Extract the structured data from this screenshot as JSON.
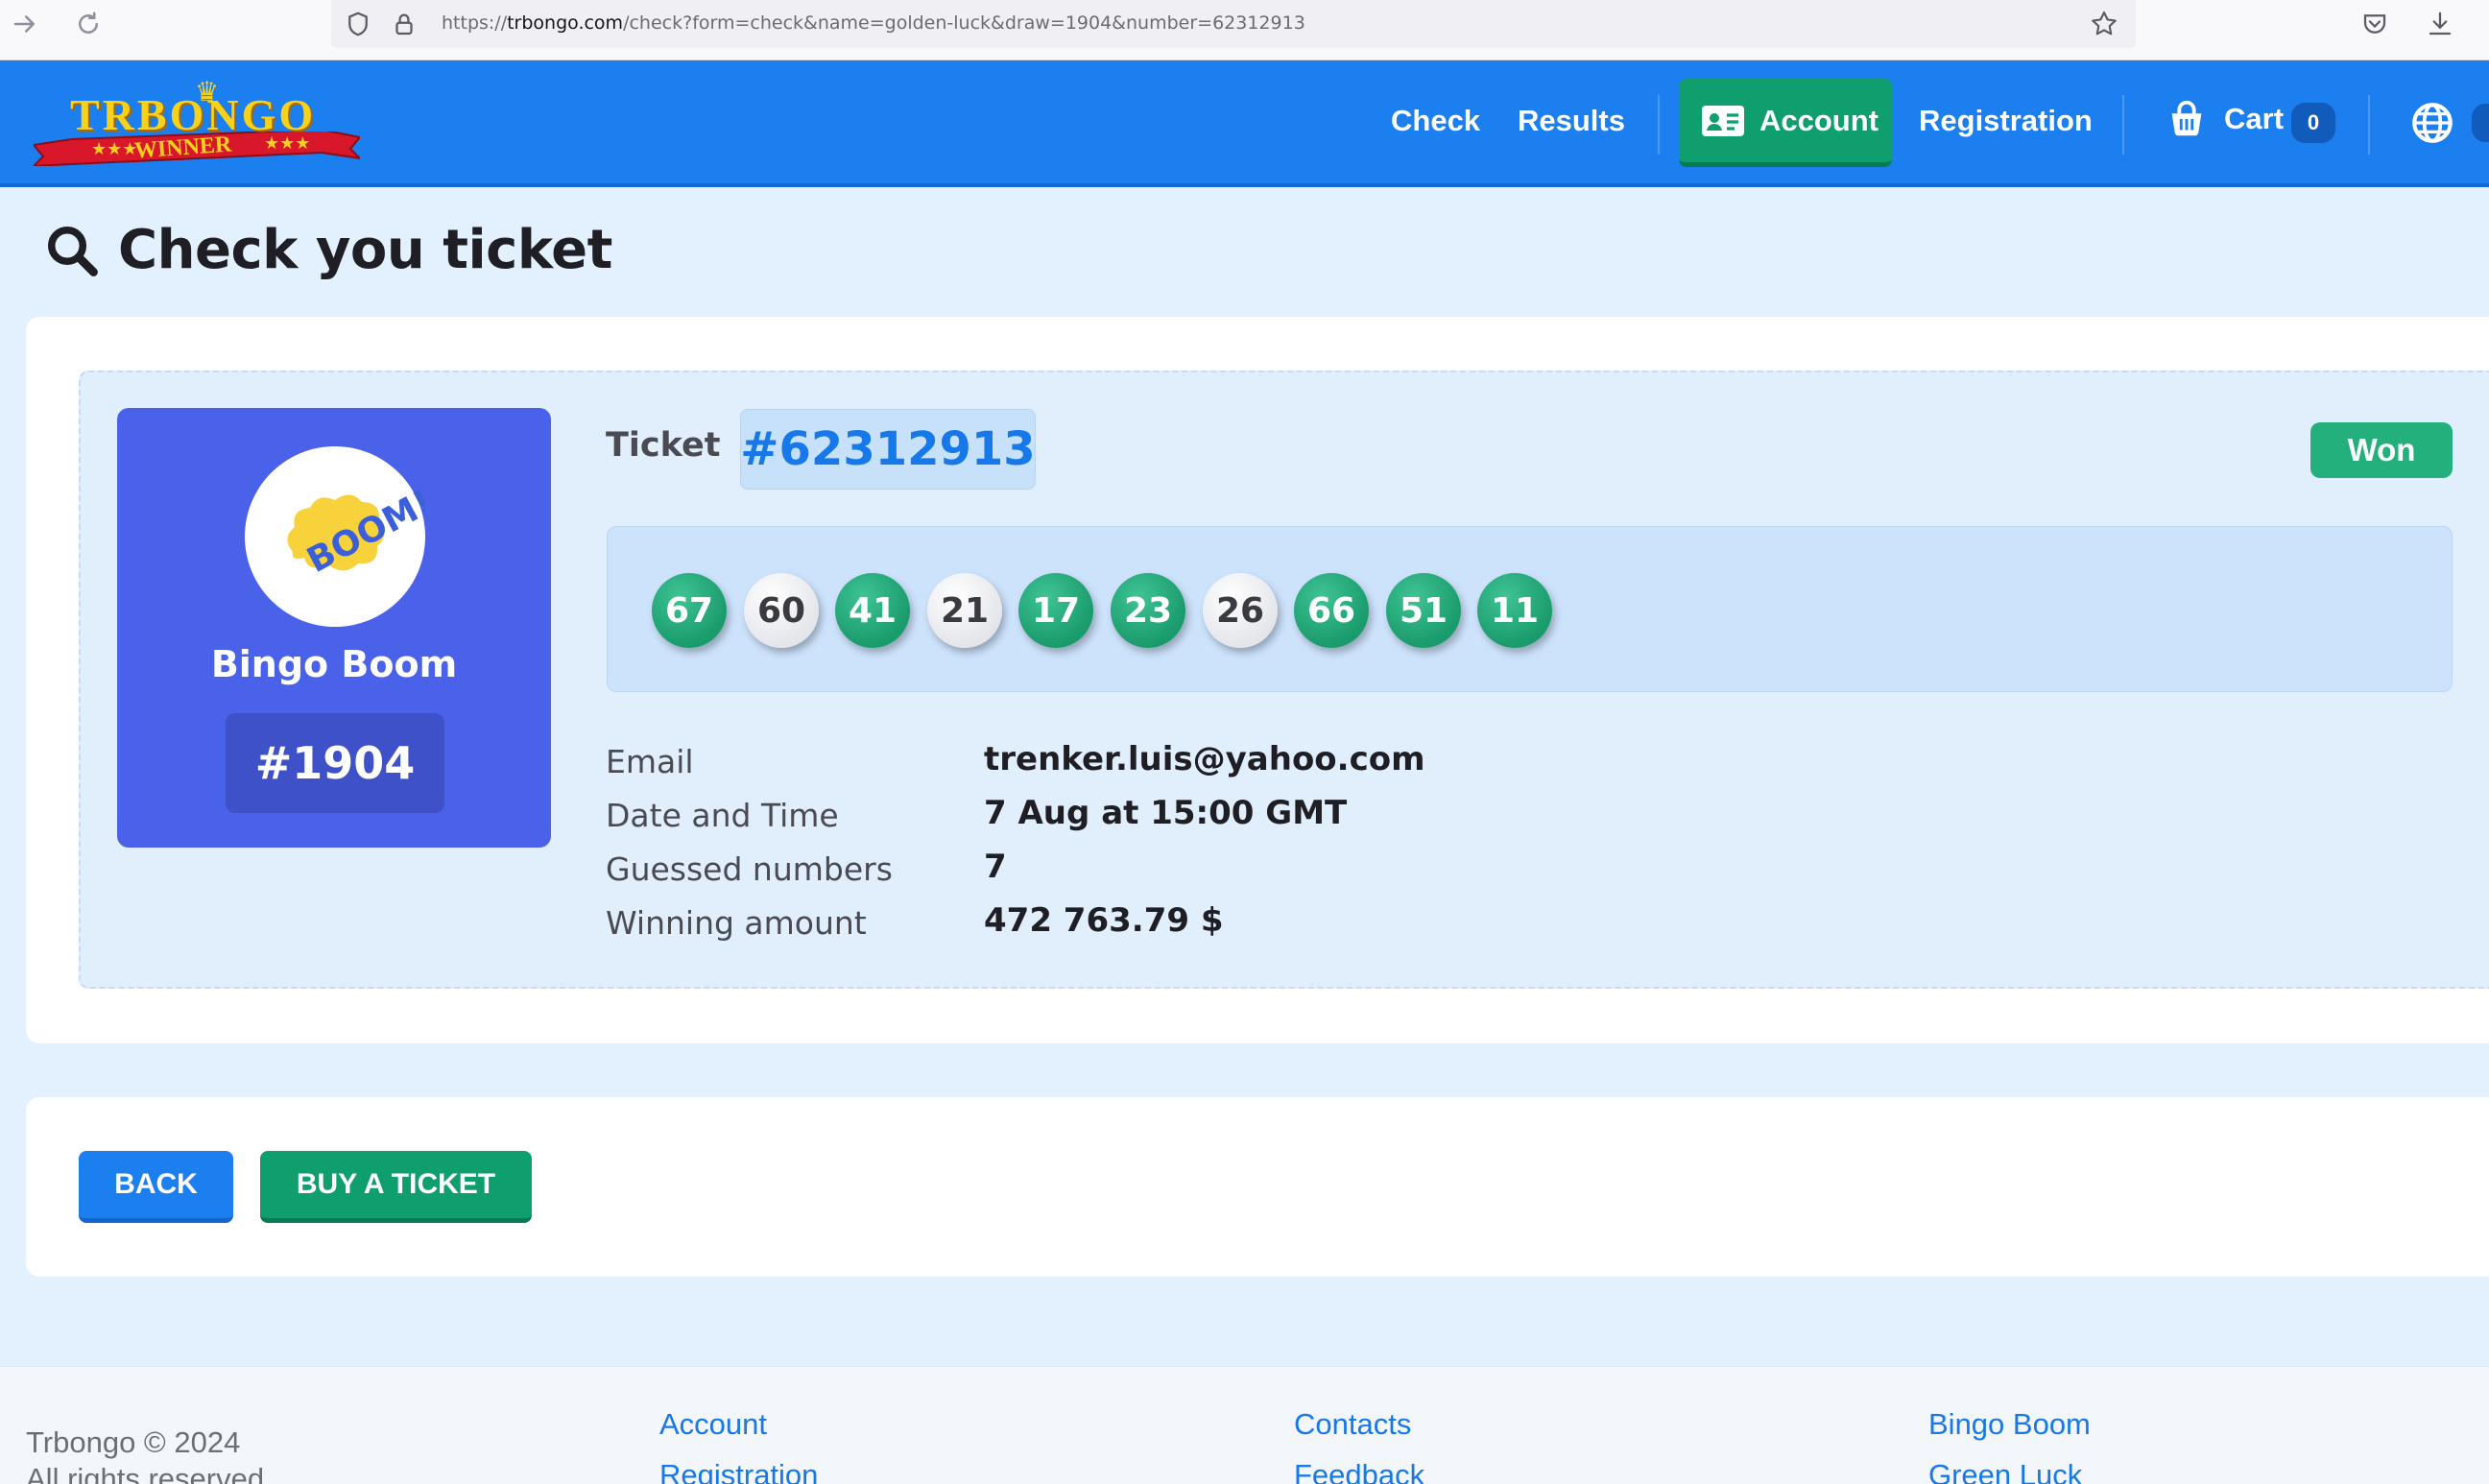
{
  "browser": {
    "url_prefix": "https://",
    "url_host": "trbongo.com",
    "url_path": "/check?form=check&name=golden-luck&draw=1904&number=62312913"
  },
  "header": {
    "logo_brand": "TRBONGO",
    "logo_ribbon": "WINNER",
    "nav": {
      "check": "Check",
      "results": "Results",
      "account": "Account",
      "registration": "Registration",
      "cart": "Cart",
      "cart_count": "0"
    }
  },
  "page": {
    "title": "Check you ticket"
  },
  "game": {
    "name": "Bingo Boom",
    "draw": "#1904",
    "logo_text": "BOOM!"
  },
  "ticket": {
    "label": "Ticket",
    "number": "#62312913",
    "status": "Won",
    "balls": [
      {
        "n": "67",
        "hit": true
      },
      {
        "n": "60",
        "hit": false
      },
      {
        "n": "41",
        "hit": true
      },
      {
        "n": "21",
        "hit": false
      },
      {
        "n": "17",
        "hit": true
      },
      {
        "n": "23",
        "hit": true
      },
      {
        "n": "26",
        "hit": false
      },
      {
        "n": "66",
        "hit": true
      },
      {
        "n": "51",
        "hit": true
      },
      {
        "n": "11",
        "hit": true
      }
    ],
    "details": [
      {
        "label": "Email",
        "value": "trenker.luis@yahoo.com"
      },
      {
        "label": "Date and Time",
        "value": "7 Aug at 15:00 GMT"
      },
      {
        "label": "Guessed numbers",
        "value": "7"
      },
      {
        "label": "Winning amount",
        "value": "472 763.79 $"
      }
    ]
  },
  "actions": {
    "back": "BACK",
    "buy": "BUY A TICKET"
  },
  "footer": {
    "copyright": "Trbongo © 2024",
    "rights": "All rights reserved",
    "col1": [
      "Account",
      "Registration"
    ],
    "col2": [
      "Contacts",
      "Feedback"
    ],
    "col3": [
      "Bingo Boom",
      "Green Luck"
    ]
  },
  "colors": {
    "header_blue": "#1b7ff0",
    "accent_green": "#0f9e6e",
    "game_box": "#4a62e9",
    "page_bg": "#e3f0fe"
  }
}
